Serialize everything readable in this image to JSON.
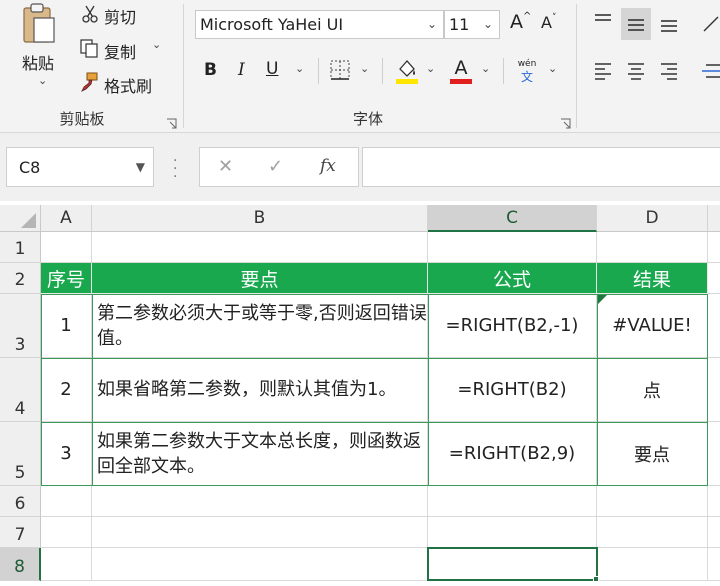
{
  "ribbon": {
    "clipboard": {
      "paste_label": "粘贴",
      "cut_label": "剪切",
      "copy_label": "复制",
      "format_painter_label": "格式刷",
      "group_label": "剪贴板"
    },
    "font": {
      "font_name": "Microsoft YaHei UI",
      "font_size": "11",
      "increase_size": "A",
      "decrease_size": "A",
      "bold": "B",
      "italic": "I",
      "underline": "U",
      "font_color_glyph": "A",
      "phonetic_top": "wén",
      "phonetic_bottom": "文",
      "group_label": "字体",
      "fill_color": "#ffe600",
      "font_color": "#e0201f"
    }
  },
  "formula_bar": {
    "name_box": "C8",
    "cancel_glyph": "✕",
    "enter_glyph": "✓",
    "fx_glyph": "fx",
    "formula": ""
  },
  "grid": {
    "columns": [
      "A",
      "B",
      "C",
      "D"
    ],
    "rows": [
      "1",
      "2",
      "3",
      "4",
      "5",
      "6",
      "7",
      "8"
    ],
    "selected_cell": "C8",
    "header_row": [
      "序号",
      "要点",
      "公式",
      "结果"
    ],
    "data_rows": [
      [
        "1",
        "第二参数必须大于或等于零,否则返回错误值。",
        "=RIGHT(B2,-1)",
        "#VALUE!"
      ],
      [
        "2",
        "如果省略第二参数，则默认其值为1。",
        "=RIGHT(B2)",
        "点"
      ],
      [
        "3",
        "如果第二参数大于文本总长度，则函数返回全部文本。",
        "=RIGHT(B2,9)",
        "要点"
      ]
    ],
    "header_fill": "#1aa84f",
    "accent": "#217346"
  }
}
